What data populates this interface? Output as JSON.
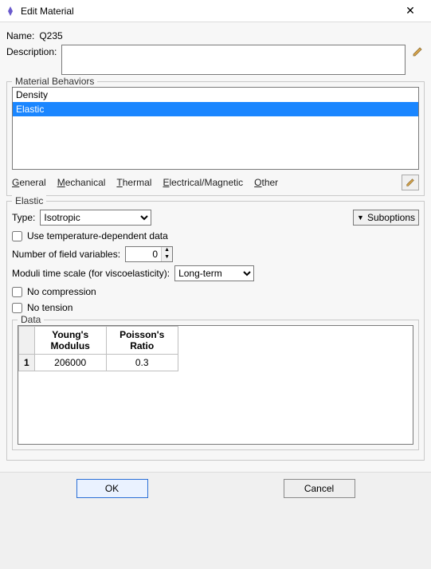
{
  "titlebar": {
    "title": "Edit Material",
    "close": "✕"
  },
  "name_label": "Name:",
  "name_value": "Q235",
  "description_label": "Description:",
  "description_value": "",
  "behaviors": {
    "legend": "Material Behaviors",
    "items": [
      "Density",
      "Elastic"
    ],
    "selected_index": 1,
    "menu": {
      "general": "General",
      "mechanical": "Mechanical",
      "thermal": "Thermal",
      "electrical": "Electrical/Magnetic",
      "other": "Other"
    }
  },
  "elastic": {
    "legend": "Elastic",
    "type_label": "Type:",
    "type_value": "Isotropic",
    "suboptions_label": "Suboptions",
    "use_temp_label": "Use temperature-dependent data",
    "use_temp_checked": false,
    "nfv_label": "Number of field variables:",
    "nfv_value": 0,
    "moduli_label": "Moduli time scale (for viscoelasticity):",
    "moduli_value": "Long-term",
    "no_compression_label": "No compression",
    "no_compression_checked": false,
    "no_tension_label": "No tension",
    "no_tension_checked": false,
    "data_legend": "Data",
    "columns": [
      "Young's Modulus",
      "Poisson's Ratio"
    ],
    "rows": [
      {
        "n": 1,
        "values": [
          206000,
          0.3
        ]
      }
    ]
  },
  "footer": {
    "ok": "OK",
    "cancel": "Cancel"
  }
}
